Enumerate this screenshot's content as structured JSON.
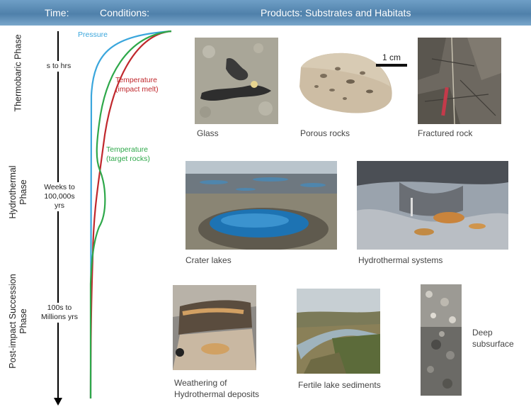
{
  "header": {
    "time_label": "Time:",
    "conditions_label": "Conditions:",
    "products_label": "Products: Substrates and Habitats",
    "bar_color": "#4f80aa"
  },
  "phases": [
    {
      "name": "Thermobaric Phase",
      "time": "s to hrs"
    },
    {
      "name": "Hydrothermal Phase",
      "time": "Weeks to 100,000s yrs"
    },
    {
      "name": "Post-impact Succession Phase",
      "time": "100s to Millions yrs"
    }
  ],
  "curves": {
    "pressure": {
      "label": "Pressure",
      "color": "#3aa6dc"
    },
    "temp_melt": {
      "label_line1": "Temperature",
      "label_line2": "(impact melt)",
      "color": "#c0282d"
    },
    "temp_target": {
      "label_line1": "Temperature",
      "label_line2": "(target rocks)",
      "color": "#2ea84a"
    }
  },
  "products": {
    "glass": "Glass",
    "porous": "Porous rocks",
    "scale_bar": "1 cm",
    "fractured": "Fractured rock",
    "crater_lakes": "Crater lakes",
    "hydrothermal": "Hydrothermal systems",
    "weathering_line1": "Weathering of",
    "weathering_line2": "Hydrothermal deposits",
    "fertile": "Fertile lake sediments",
    "deep_line1": "Deep",
    "deep_line2": "subsurface"
  }
}
